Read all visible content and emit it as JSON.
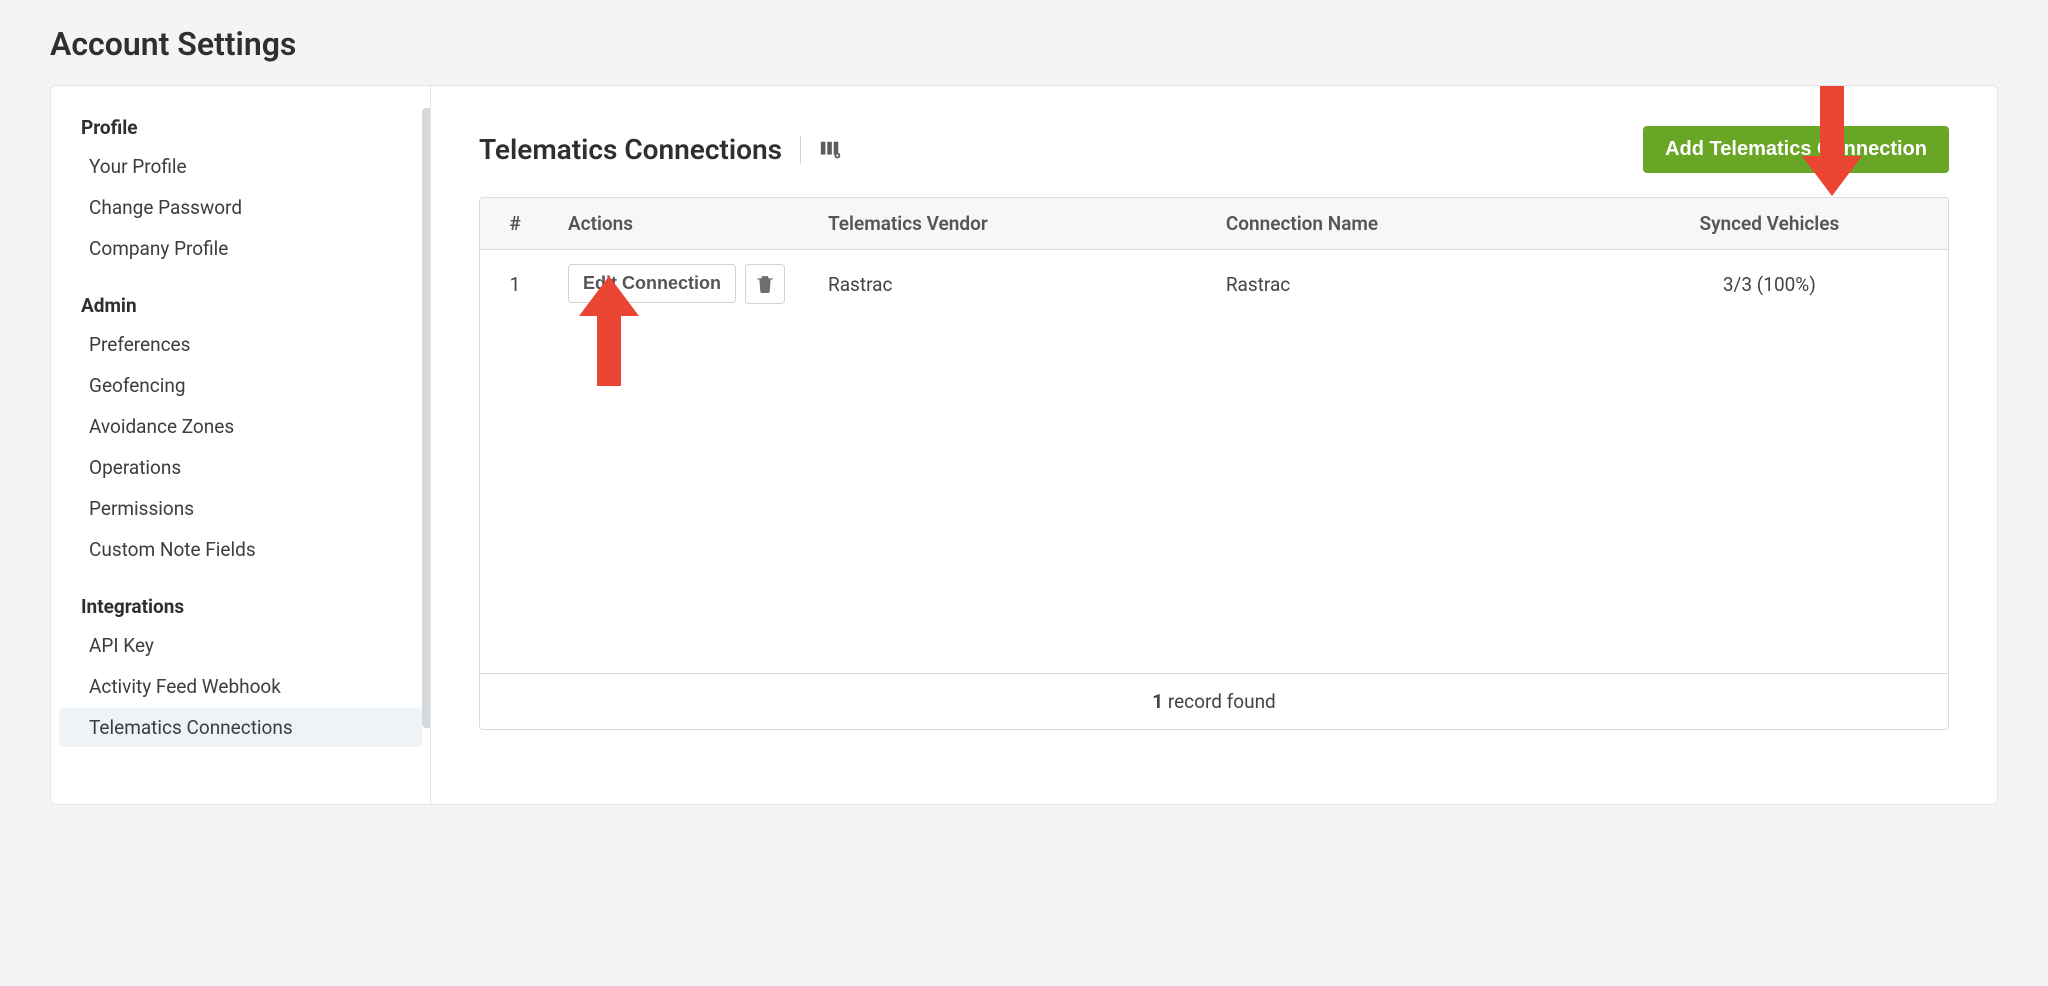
{
  "page": {
    "title": "Account Settings"
  },
  "sidebar": {
    "sections": [
      {
        "header": "Profile",
        "items": [
          {
            "label": "Your Profile",
            "active": false
          },
          {
            "label": "Change Password",
            "active": false
          },
          {
            "label": "Company Profile",
            "active": false
          }
        ]
      },
      {
        "header": "Admin",
        "items": [
          {
            "label": "Preferences",
            "active": false
          },
          {
            "label": "Geofencing",
            "active": false
          },
          {
            "label": "Avoidance Zones",
            "active": false
          },
          {
            "label": "Operations",
            "active": false
          },
          {
            "label": "Permissions",
            "active": false
          },
          {
            "label": "Custom Note Fields",
            "active": false
          }
        ]
      },
      {
        "header": "Integrations",
        "items": [
          {
            "label": "API Key",
            "active": false
          },
          {
            "label": "Activity Feed Webhook",
            "active": false
          },
          {
            "label": "Telematics Connections",
            "active": true
          }
        ]
      }
    ]
  },
  "main": {
    "title": "Telematics Connections",
    "add_button": "Add Telematics Connection",
    "columns": {
      "num": "#",
      "actions": "Actions",
      "vendor": "Telematics Vendor",
      "name": "Connection Name",
      "synced": "Synced Vehicles"
    },
    "rows": [
      {
        "num": "1",
        "edit_label": "Edit Connection",
        "vendor": "Rastrac",
        "name": "Rastrac",
        "synced": "3/3 (100%)"
      }
    ],
    "footer_count": "1",
    "footer_text": " record found"
  }
}
